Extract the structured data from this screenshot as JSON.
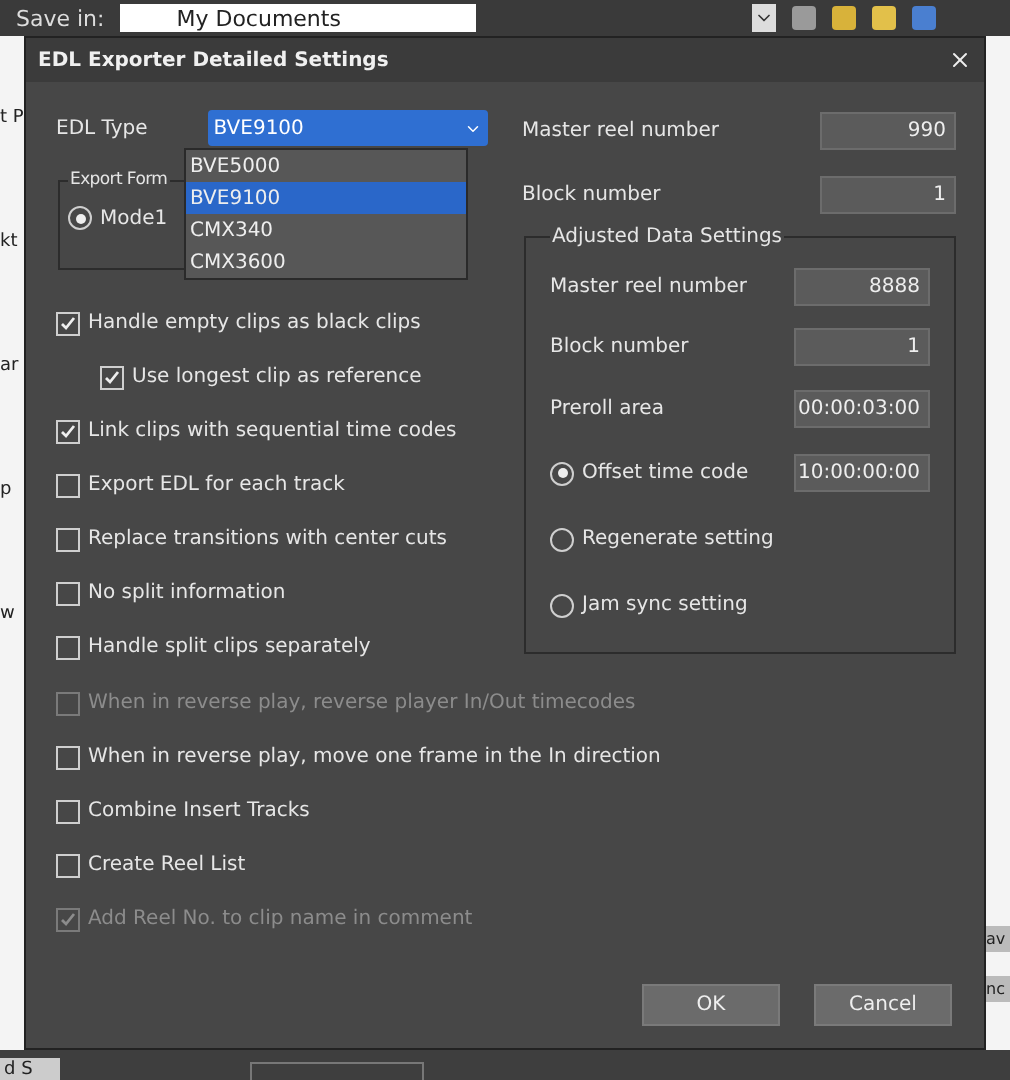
{
  "background": {
    "save_in_label": "Save in:",
    "save_in_value": "My Documents",
    "left_fragments": [
      "t P",
      "kt",
      "ar",
      "p",
      "w"
    ],
    "bottom_fragment": "d S",
    "right_fragments": [
      "av",
      "nc"
    ]
  },
  "dialog": {
    "title": "EDL Exporter Detailed Settings"
  },
  "edl_type": {
    "label": "EDL Type",
    "value": "BVE9100",
    "expanded": true,
    "options": [
      {
        "label": "BVE5000",
        "selected": false
      },
      {
        "label": "BVE9100",
        "selected": true
      },
      {
        "label": "CMX340",
        "selected": false
      },
      {
        "label": "CMX3600",
        "selected": false
      }
    ]
  },
  "export_format": {
    "legend": "Export Form",
    "modes": [
      {
        "label": "Mode1",
        "selected": true
      }
    ]
  },
  "left_options": [
    {
      "label": "Handle empty clips as black clips",
      "checked": true,
      "disabled": false,
      "children": [
        {
          "label": "Use longest clip as reference",
          "checked": true,
          "disabled": false
        }
      ]
    },
    {
      "label": "Link clips with sequential time codes",
      "checked": true,
      "disabled": false
    },
    {
      "label": "Export EDL for each track",
      "checked": false,
      "disabled": false
    },
    {
      "label": "Replace transitions with center cuts",
      "checked": false,
      "disabled": false
    },
    {
      "label": "No split information",
      "checked": false,
      "disabled": false
    },
    {
      "label": "Handle split clips separately",
      "checked": false,
      "disabled": false
    }
  ],
  "bottom_options": [
    {
      "label": "When in reverse play, reverse player In/Out timecodes",
      "checked": false,
      "disabled": true
    },
    {
      "label": "When in reverse play, move one frame in the In direction",
      "checked": false,
      "disabled": false
    },
    {
      "label": "Combine Insert Tracks",
      "checked": false,
      "disabled": false
    },
    {
      "label": "Create Reel List",
      "checked": false,
      "disabled": false
    },
    {
      "label": "Add Reel No. to clip name in comment",
      "checked": true,
      "disabled": true
    }
  ],
  "top_fields": [
    {
      "label": "Master reel number",
      "value": "990"
    },
    {
      "label": "Block number",
      "value": "1"
    }
  ],
  "adjusted": {
    "legend": "Adjusted Data Settings",
    "fields": [
      {
        "label": "Master reel number",
        "value": "8888"
      },
      {
        "label": "Block number",
        "value": "1"
      },
      {
        "label": "Preroll area",
        "value": "00:00:03:00"
      }
    ],
    "modes": [
      {
        "label": "Offset time code",
        "selected": true,
        "value": "10:00:00:00"
      },
      {
        "label": "Regenerate setting",
        "selected": false
      },
      {
        "label": "Jam sync setting",
        "selected": false
      }
    ]
  },
  "buttons": [
    "OK",
    "Cancel"
  ]
}
